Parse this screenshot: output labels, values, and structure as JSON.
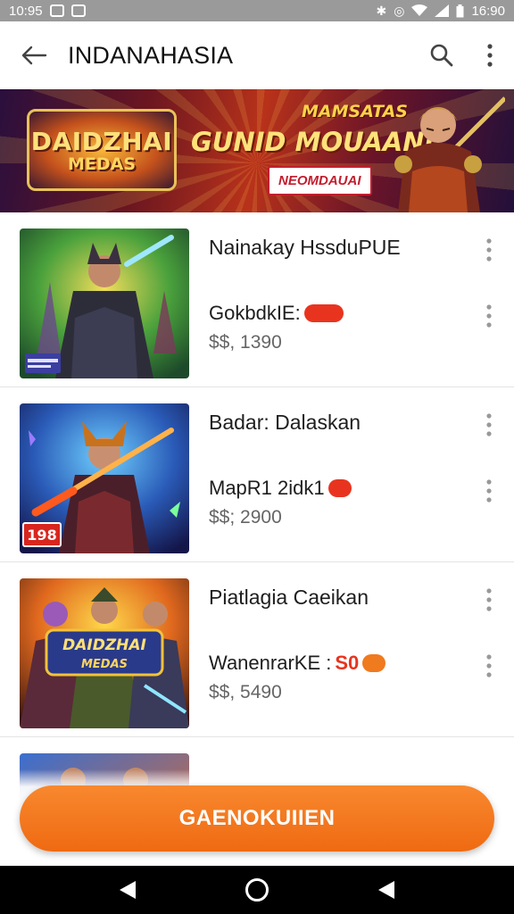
{
  "status_bar": {
    "time_left": "10:95",
    "time_right": "16:90",
    "icons": [
      "notification-box-icon",
      "app-box-icon",
      "bluetooth-icon",
      "alarm-icon",
      "wifi-icon",
      "signal-icon",
      "battery-icon"
    ]
  },
  "app_bar": {
    "title": "INDANAHASIA",
    "back_icon": "arrow-left-icon",
    "search_icon": "search-icon",
    "more_icon": "more-vertical-icon"
  },
  "banner": {
    "logo_line1": "DAIDZHAI",
    "logo_line2": "MEDAS",
    "tagline": "MAMSATAS",
    "headline": "GUNID MOUAANI",
    "cta": "NEOMDAUAI"
  },
  "items": [
    {
      "title": "Nainakay HssduPUE",
      "subtitle": "GokbdkIE:",
      "badge": "",
      "price": "$$, 1390",
      "thumb_badge": "",
      "colors": {
        "bg1": "#2c7d3a",
        "bg2": "#d9c23a"
      }
    },
    {
      "title": "Badar: Dalaskan",
      "subtitle": "MapR1 2idk1",
      "badge": "",
      "price": "$$; 2900",
      "thumb_badge": "198",
      "colors": {
        "bg1": "#1c2c7a",
        "bg2": "#2b8bd0"
      }
    },
    {
      "title": "Piatlagia Caeikan",
      "subtitle": "WanenrarKE :",
      "badge_red_text": "S0",
      "badge": "",
      "price": "$$, 5490",
      "thumb_badge": "",
      "thumb_logo_line1": "DAIDZHAI",
      "thumb_logo_line2": "MEDAS",
      "colors": {
        "bg1": "#d6601a",
        "bg2": "#f2c23a"
      }
    }
  ],
  "bottom_button": {
    "label": "GAENOKUIIEN"
  },
  "colors": {
    "accent": "#f07a1e",
    "badge_red": "#e8341f"
  }
}
